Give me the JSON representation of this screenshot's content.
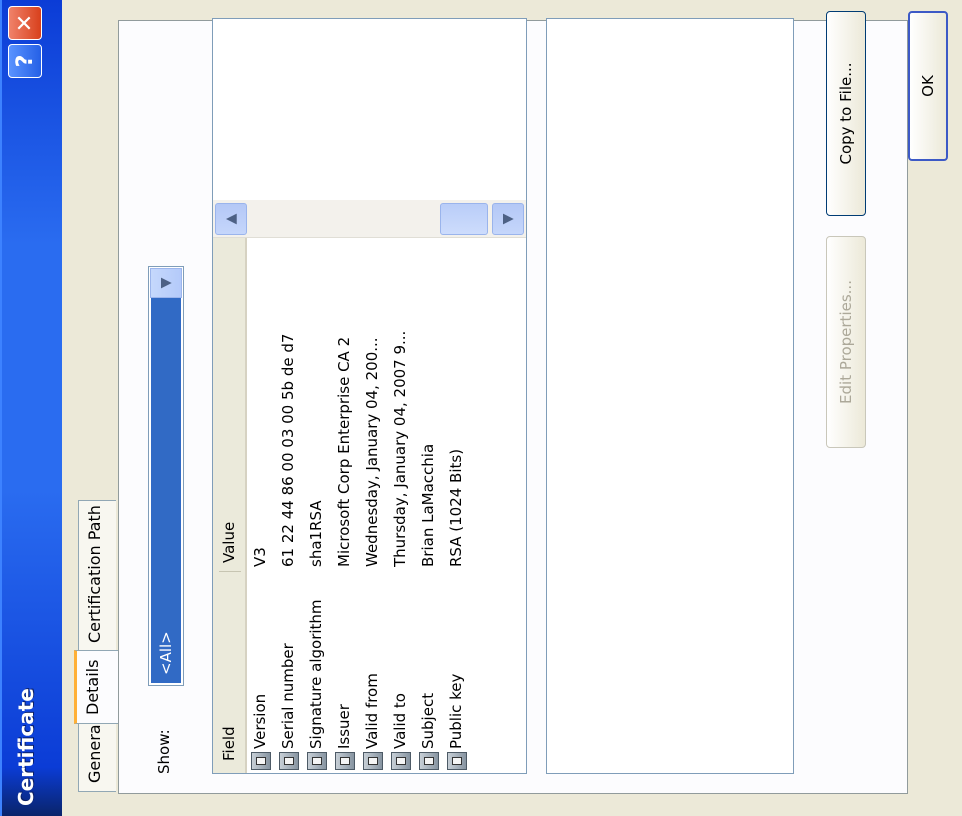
{
  "window": {
    "title": "Certificate",
    "help_label": "?",
    "close_label": "✕"
  },
  "tabs": [
    {
      "label": "General",
      "active": false
    },
    {
      "label": "Details",
      "active": true
    },
    {
      "label": "Certification Path",
      "active": false
    }
  ],
  "show": {
    "label": "Show:",
    "value": "<All>"
  },
  "list": {
    "columns": [
      "Field",
      "Value"
    ],
    "rows": [
      {
        "field": "Version",
        "value": "V3"
      },
      {
        "field": "Serial number",
        "value": "61 22 44 86 00 03 00 5b de d7"
      },
      {
        "field": "Signature algorithm",
        "value": "sha1RSA"
      },
      {
        "field": "Issuer",
        "value": "Microsoft Corp Enterprise CA 2"
      },
      {
        "field": "Valid from",
        "value": "Wednesday, January 04, 200..."
      },
      {
        "field": "Valid to",
        "value": "Thursday, January 04, 2007 9..."
      },
      {
        "field": "Subject",
        "value": "Brian LaMacchia"
      },
      {
        "field": "Public key",
        "value": "RSA (1024 Bits)"
      }
    ]
  },
  "buttons": {
    "edit_properties": "Edit Properties...",
    "copy_to_file": "Copy to File...",
    "ok": "OK"
  },
  "colors": {
    "title_bar": "#2a6cf0",
    "selection": "#316ac5",
    "dialog_bg": "#ece9d8",
    "active_tab_accent": "#ffb036"
  }
}
